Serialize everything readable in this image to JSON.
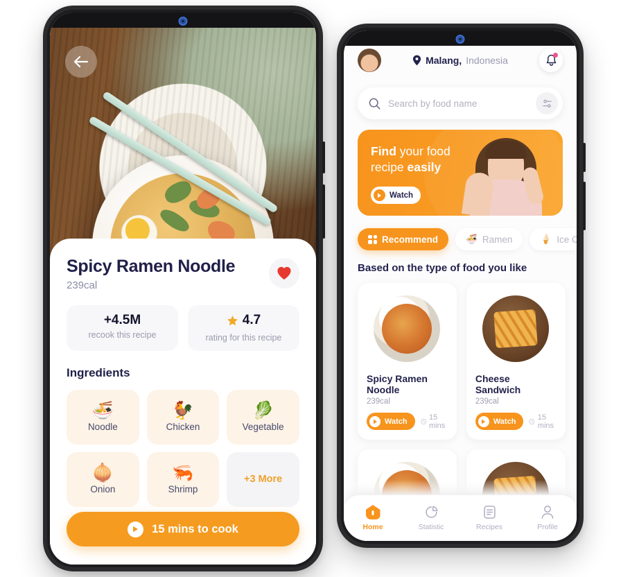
{
  "recipe_detail": {
    "back_icon": "arrow-left-icon",
    "title": "Spicy Ramen Noodle",
    "calories": "239cal",
    "favorite_icon": "heart-icon",
    "stats": [
      {
        "value": "+4.5M",
        "label": "recook this recipe"
      },
      {
        "value": "4.7",
        "label": "rating for this recipe",
        "icon": "star-icon"
      }
    ],
    "ingredients_title": "Ingredients",
    "ingredients": [
      {
        "emoji": "🍜",
        "label": "Noodle"
      },
      {
        "emoji": "🐓",
        "label": "Chicken"
      },
      {
        "emoji": "🥬",
        "label": "Vegetable"
      },
      {
        "emoji": "🧅",
        "label": "Onion"
      },
      {
        "emoji": "🦐",
        "label": "Shrimp"
      }
    ],
    "more_label": "+3 More",
    "cook_button": "15 mins to cook",
    "cook_icon": "play-icon"
  },
  "home": {
    "avatar_icon": "avatar",
    "location_city": "Malang,",
    "location_country": "Indonesia",
    "location_icon": "map-pin-icon",
    "bell_icon": "bell-icon",
    "search": {
      "placeholder": "Search by food name",
      "value": "",
      "search_icon": "search-icon",
      "filter_icon": "sliders-icon"
    },
    "promo": {
      "line1_bold": "Find",
      "line1_rest": " your food",
      "line2_rest": "recipe ",
      "line2_bold": "easily",
      "watch_label": "Watch",
      "watch_icon": "play-icon"
    },
    "chips": [
      {
        "label": "Recommend",
        "icon": "grid-icon",
        "active": true
      },
      {
        "label": "Ramen",
        "icon": "🍜",
        "active": false
      },
      {
        "label": "Ice Cream",
        "icon": "🍦",
        "active": false
      }
    ],
    "section_title": "Based on the type of food you like",
    "cards": [
      {
        "name": "Spicy Ramen Noodle",
        "calories": "239cal",
        "watch_label": "Watch",
        "time": "15 mins",
        "clock_icon": "clock-icon"
      },
      {
        "name": "Cheese Sandwich",
        "calories": "239cal",
        "watch_label": "Watch",
        "time": "15 mins",
        "clock_icon": "clock-icon"
      }
    ],
    "nav": [
      {
        "label": "Home",
        "icon": "home-icon",
        "active": true
      },
      {
        "label": "Statistic",
        "icon": "pie-chart-icon",
        "active": false
      },
      {
        "label": "Recipes",
        "icon": "document-icon",
        "active": false
      },
      {
        "label": "Profile",
        "icon": "person-icon",
        "active": false
      }
    ]
  },
  "colors": {
    "accent": "#f7941d",
    "accent_dark": "#f59c20",
    "navy": "#22224d",
    "muted": "#a0a0b4",
    "heart": "#e8392f",
    "badge": "#f2558a"
  }
}
